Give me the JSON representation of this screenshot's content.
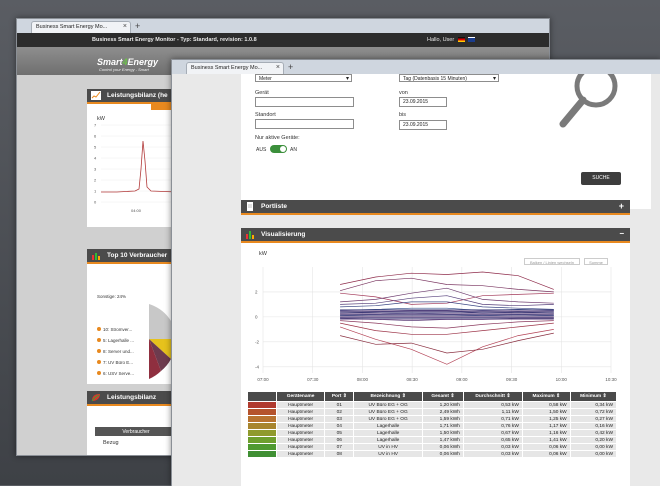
{
  "back_window": {
    "tab_title": "Business Smart Energy Mo...",
    "nav_title": "Business Smart Energy Monitor - Typ: Standard, revision: 1.0.8",
    "user_greeting": "Hallo,  User",
    "logo_main": "Smart",
    "logo_digit": "4",
    "logo_end": "Energy",
    "logo_tagline": "Control your Energy - Smart",
    "panel1_title": "Leistungsbilanz (he",
    "panel1_unit": "kW",
    "panel1_yticks": [
      "7",
      "6",
      "5",
      "4",
      "3",
      "2",
      "1",
      "0"
    ],
    "panel1_xtick": "04:00",
    "panel2_title": "Top 10 Verbraucher",
    "panel2_legend": [
      "Sonstige: 24%",
      "10: Stromver...",
      "5: Lagerhalle ...",
      "8: Server und...",
      "7: UV Büro E...",
      "6: USV Serve..."
    ],
    "panel3_title": "Leistungsbilanz",
    "panel3_col": "Verbraucher",
    "panel3_row": "Bezug"
  },
  "front_window": {
    "tab_title": "Business Smart Energy Mo...",
    "select_unit": "Meter",
    "select_period": "Tag (Datenbasis 15 Minuten)",
    "label_device": "Gerät",
    "label_from": "von",
    "value_from": "23.09.2015",
    "label_location": "Standort",
    "label_to": "bis",
    "value_to": "23.09.2015",
    "label_active": "Nur aktive Geräte:",
    "toggle_off": "AUS",
    "toggle_on": "AN",
    "search_button": "SUCHE",
    "portliste_title": "Portliste",
    "portliste_toggle": "+",
    "visual_title": "Visualisierung",
    "visual_toggle": "−",
    "chart_btn_1": "Balken / Linien wechseln",
    "chart_btn_2": "Summe",
    "table_headers": [
      "",
      "Gerätename",
      "Port",
      "Bezeichnung",
      "Gesamt",
      "Durchschnitt",
      "Maximum",
      "Minimum"
    ],
    "table_rows": [
      {
        "color": "#b03a2e",
        "name": "Hauptmeter",
        "port": "01",
        "desc": "UV Büro EG + OG",
        "total": "1,20 kWh",
        "avg": "0,53 kW",
        "max": "0,58 kW",
        "min": "0,34 kW"
      },
      {
        "color": "#b5532c",
        "name": "Hauptmeter",
        "port": "02",
        "desc": "UV Büro EG + OG",
        "total": "2,49 kWh",
        "avg": "1,11 kW",
        "max": "1,50 kW",
        "min": "0,72 kW"
      },
      {
        "color": "#b87330",
        "name": "Hauptmeter",
        "port": "03",
        "desc": "UV Büro EG + OG",
        "total": "1,59 kWh",
        "avg": "0,71 kW",
        "max": "1,25 kW",
        "min": "0,27 kW"
      },
      {
        "color": "#a8852e",
        "name": "Hauptmeter",
        "port": "04",
        "desc": "Lagerhalle",
        "total": "1,71 kWh",
        "avg": "0,76 kW",
        "max": "1,17 kW",
        "min": "0,16 kW"
      },
      {
        "color": "#8f9a2c",
        "name": "Hauptmeter",
        "port": "05",
        "desc": "Lagerhalle",
        "total": "1,50 kWh",
        "avg": "0,67 kW",
        "max": "1,16 kW",
        "min": "0,42 kW"
      },
      {
        "color": "#6e9f2d",
        "name": "Hauptmeter",
        "port": "06",
        "desc": "Lagerhalle",
        "total": "1,47 kWh",
        "avg": "0,65 kW",
        "max": "1,41 kW",
        "min": "0,20 kW"
      },
      {
        "color": "#4f9a30",
        "name": "Hauptmeter",
        "port": "07",
        "desc": "UV in HV",
        "total": "0,06 kWh",
        "avg": "0,03 kW",
        "max": "0,06 kW",
        "min": "0,00 kW"
      },
      {
        "color": "#3f8f33",
        "name": "Hauptmeter",
        "port": "08",
        "desc": "UV in HV",
        "total": "0,06 kWh",
        "avg": "0,03 kW",
        "max": "0,06 kW",
        "min": "0,00 kW"
      }
    ]
  },
  "chart_data": {
    "type": "line",
    "ylabel": "kW",
    "yticks": [
      "2",
      "0",
      "-2",
      "-4"
    ],
    "ylim": [
      -4.5,
      4
    ],
    "x": [
      "07:00",
      "07:30",
      "08:00",
      "08:30",
      "09:00",
      "09:30",
      "10:00",
      "10:30"
    ],
    "grid": true,
    "series": [
      {
        "color": "#8e2b4a",
        "values": [
          2.6,
          3.2,
          3.5,
          3.4,
          3.6,
          3.3,
          2.2
        ]
      },
      {
        "color": "#7a3560",
        "values": [
          2.1,
          2.9,
          3.1,
          2.6,
          2.5,
          2.2,
          2.0
        ]
      },
      {
        "color": "#a33a5a",
        "values": [
          1.9,
          1.6,
          1.0,
          1.1,
          1.7,
          1.8,
          1.9
        ]
      },
      {
        "color": "#6d3b6e",
        "values": [
          1.2,
          1.4,
          1.9,
          2.3,
          1.4,
          1.2,
          1.1
        ]
      },
      {
        "color": "#553f7a",
        "values": [
          1.0,
          1.1,
          1.5,
          1.7,
          1.0,
          0.9,
          1.0
        ]
      },
      {
        "color": "#3e4a86",
        "values": [
          0.8,
          0.9,
          1.2,
          1.2,
          0.8,
          0.7,
          0.6
        ]
      },
      {
        "color": "#364f8b",
        "values": [
          0.5,
          0.6,
          0.7,
          0.7,
          0.5,
          0.6,
          0.5
        ]
      },
      {
        "color": "#2d2d6d",
        "values": [
          0.3,
          0.4,
          0.5,
          0.5,
          0.3,
          0.4,
          0.3
        ]
      },
      {
        "color": "#4e6a9e",
        "values": [
          0.1,
          0.2,
          0.3,
          0.2,
          0.1,
          0.2,
          0.1
        ]
      },
      {
        "color": "#5e3e78",
        "values": [
          -0.1,
          -0.2,
          -0.3,
          -0.2,
          -0.2,
          -0.1,
          -0.1
        ]
      },
      {
        "color": "#8b3a5e",
        "values": [
          -0.3,
          -0.5,
          -0.8,
          -0.9,
          -0.6,
          -0.4,
          -0.3
        ]
      },
      {
        "color": "#9c3347",
        "values": [
          -0.5,
          -1.1,
          -1.4,
          -1.4,
          -1.1,
          -0.8,
          -0.5
        ]
      },
      {
        "color": "#b34255",
        "values": [
          -0.8,
          -1.8,
          -2.6,
          -3.8,
          -2.4,
          -1.5,
          -1.0
        ]
      },
      {
        "color": "#8a2f40",
        "values": [
          -1.5,
          -2.2,
          -2.1,
          -2.9,
          -2.6,
          -1.9,
          -1.3
        ]
      }
    ]
  }
}
